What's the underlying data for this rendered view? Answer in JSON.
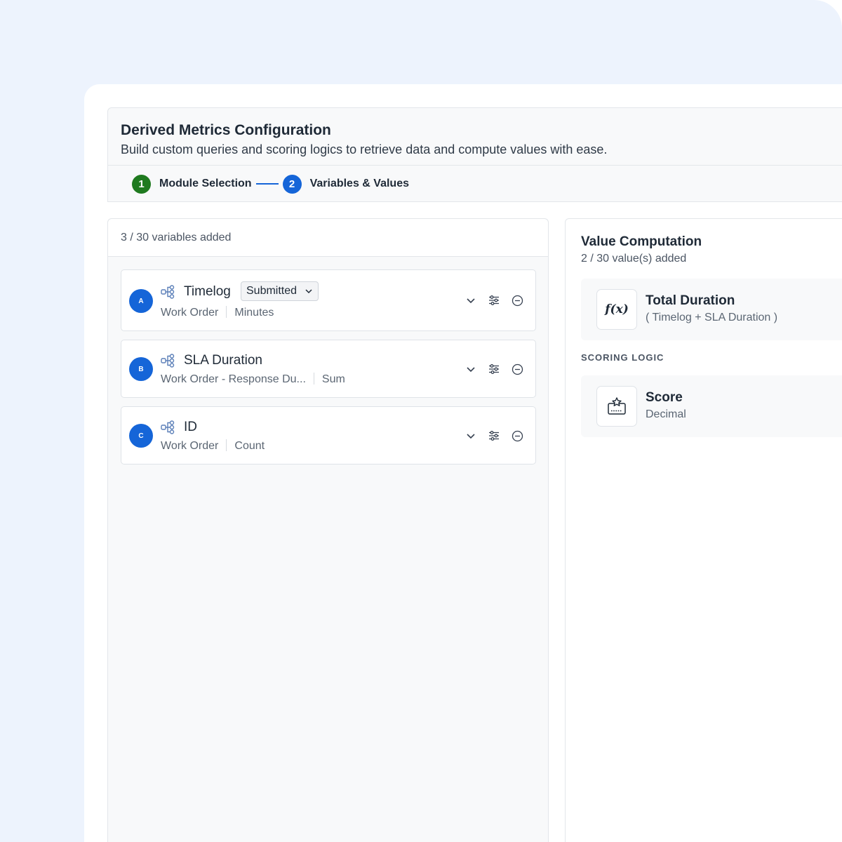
{
  "header": {
    "title": "Derived Metrics Configuration",
    "subtitle": "Build custom queries and scoring logics to retrieve data and compute values with ease."
  },
  "stepper": {
    "steps": [
      {
        "number": "1",
        "label": "Module Selection",
        "state": "complete"
      },
      {
        "number": "2",
        "label": "Variables & Values",
        "state": "active"
      }
    ]
  },
  "variables": {
    "count_text": "3 / 30 variables added",
    "items": [
      {
        "badge": "A",
        "name": "Timelog",
        "filter": "Submitted",
        "module": "Work Order",
        "aggregation": "Minutes"
      },
      {
        "badge": "B",
        "name": "SLA Duration",
        "module": "Work Order - Response Du...",
        "aggregation": "Sum"
      },
      {
        "badge": "C",
        "name": "ID",
        "module": "Work Order",
        "aggregation": "Count"
      }
    ]
  },
  "values": {
    "title": "Value Computation",
    "count_text": "2 / 30 value(s) added",
    "computations": [
      {
        "icon_text": "f(x)",
        "name": "Total Duration",
        "formula": "( Timelog + SLA Duration )"
      }
    ],
    "scoring_label": "SCORING LOGIC",
    "scoring": [
      {
        "name": "Score",
        "type": "Decimal"
      }
    ]
  },
  "colors": {
    "accent": "#1565d8",
    "success": "#1f7a1f",
    "backdrop": "#edf3fd"
  },
  "icons": [
    "module-tree-icon",
    "chevron-down-icon",
    "sliders-icon",
    "minus-circle-icon",
    "function-icon",
    "scoring-card-icon"
  ]
}
